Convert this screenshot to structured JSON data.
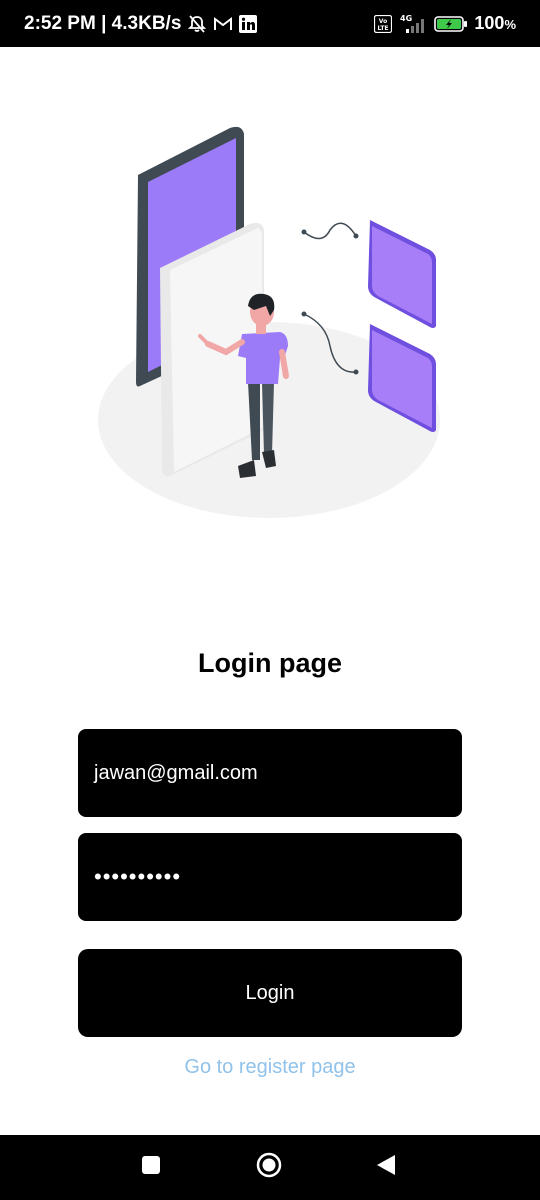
{
  "status_bar": {
    "time_speed": "2:52 PM | 4.3KB/s",
    "network": "4G",
    "volte": "Vo LTE",
    "battery": "100",
    "battery_unit": "%",
    "icons": [
      "mute-icon",
      "gmail-icon",
      "linkedin-icon",
      "volte-icon",
      "signal-icon",
      "battery-charging-icon"
    ]
  },
  "illustration": {
    "name": "person-phone-illustration",
    "colors": {
      "accent": "#9b7bf7",
      "accent_dark": "#6f4fe0",
      "phone_frame": "#3f4a53",
      "floor": "#f2f2f2"
    }
  },
  "login": {
    "title": "Login page",
    "email_value": "jawan@gmail.com",
    "password_value": "••••••••••",
    "button_label": "Login",
    "register_link": "Go to register page"
  },
  "colors": {
    "field_bg": "#000000",
    "field_text": "#ffffff",
    "link": "#90c2ea"
  },
  "nav_bar": {
    "buttons": [
      "recents-icon",
      "home-icon",
      "back-icon"
    ]
  }
}
